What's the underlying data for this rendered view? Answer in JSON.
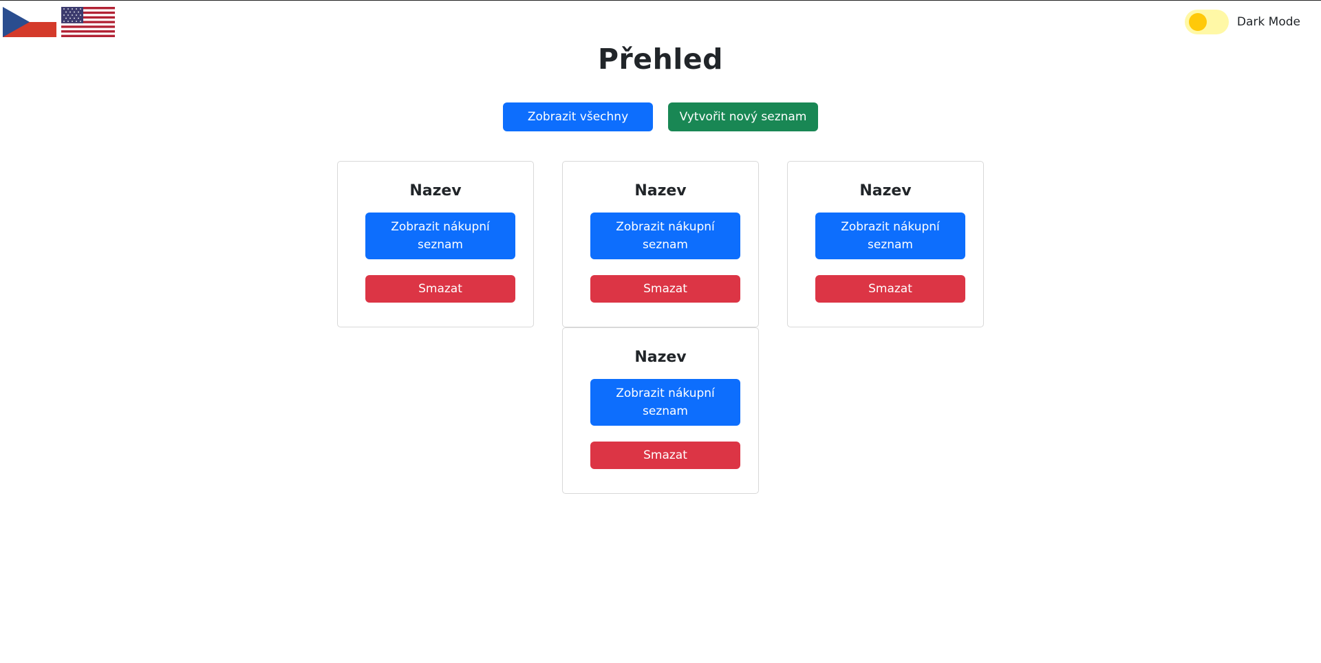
{
  "header": {
    "flags": [
      {
        "name": "czech-flag-icon"
      },
      {
        "name": "us-flag-icon"
      }
    ],
    "dark_mode_label": "Dark Mode",
    "dark_mode_on": false
  },
  "page": {
    "title": "Přehled"
  },
  "actions": {
    "show_all_label": "Zobrazit všechny",
    "create_label": "Vytvořit nový seznam"
  },
  "cards": [
    {
      "title": "Nazev",
      "view_label": "Zobrazit nákupní seznam",
      "delete_label": "Smazat"
    },
    {
      "title": "Nazev",
      "view_label": "Zobrazit nákupní seznam",
      "delete_label": "Smazat"
    },
    {
      "title": "Nazev",
      "view_label": "Zobrazit nákupní seznam",
      "delete_label": "Smazat"
    },
    {
      "title": "Nazev",
      "view_label": "Zobrazit nákupní seznam",
      "delete_label": "Smazat"
    }
  ],
  "colors": {
    "primary": "#0d6efd",
    "success": "#198754",
    "danger": "#dc3545",
    "toggle_track": "#fff8a6",
    "toggle_knob": "#ffc90a"
  }
}
